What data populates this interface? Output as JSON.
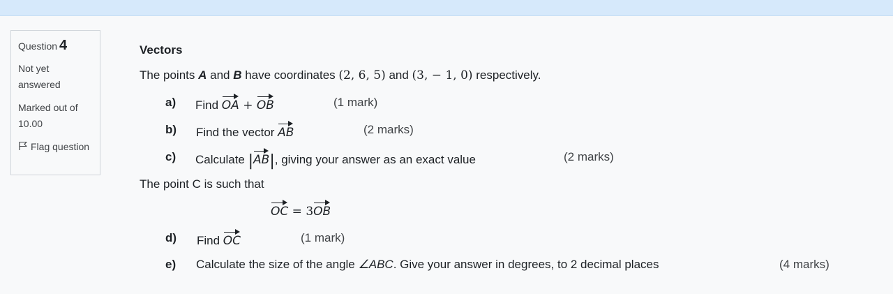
{
  "info": {
    "question_label": "Question",
    "question_number": "4",
    "state": "Not yet answered",
    "grade": "Marked out of 10.00",
    "flag_label": "Flag question"
  },
  "question": {
    "title": "Vectors",
    "intro_prefix": "The points ",
    "point_a": "A",
    "intro_and": " and ",
    "point_b": "B",
    "intro_mid": " have coordinates ",
    "coords_a": "(2, 6, 5)",
    "intro_and2": " and ",
    "coords_b": "(3, − 1, 0)",
    "intro_suffix": " respectively.",
    "parts": [
      {
        "label": "a)",
        "text": "Find ",
        "vec1": "OA",
        "op": " + ",
        "vec2": "OB",
        "marks": "(1 mark)"
      },
      {
        "label": "b)",
        "text": "Find the vector ",
        "vec1": "AB",
        "marks": "(2 marks)"
      },
      {
        "label": "c)",
        "text": "Calculate ",
        "vec1": "AB",
        "text_after": ", giving your answer as an exact value",
        "marks": "(2 marks)"
      },
      {
        "label": "d)",
        "text": "Find ",
        "vec1": "OC",
        "marks": "(1 mark)"
      },
      {
        "label": "e)",
        "text": "Calculate the size of the angle ",
        "angle": "∠ABC",
        "text_after": ".  Give your answer in degrees, to 2 decimal places",
        "marks": "(4 marks)"
      }
    ],
    "point_c_text": "The point C is such that",
    "eq_lhs": "OC",
    "eq_mid": " = 3",
    "eq_rhs": "OB"
  }
}
